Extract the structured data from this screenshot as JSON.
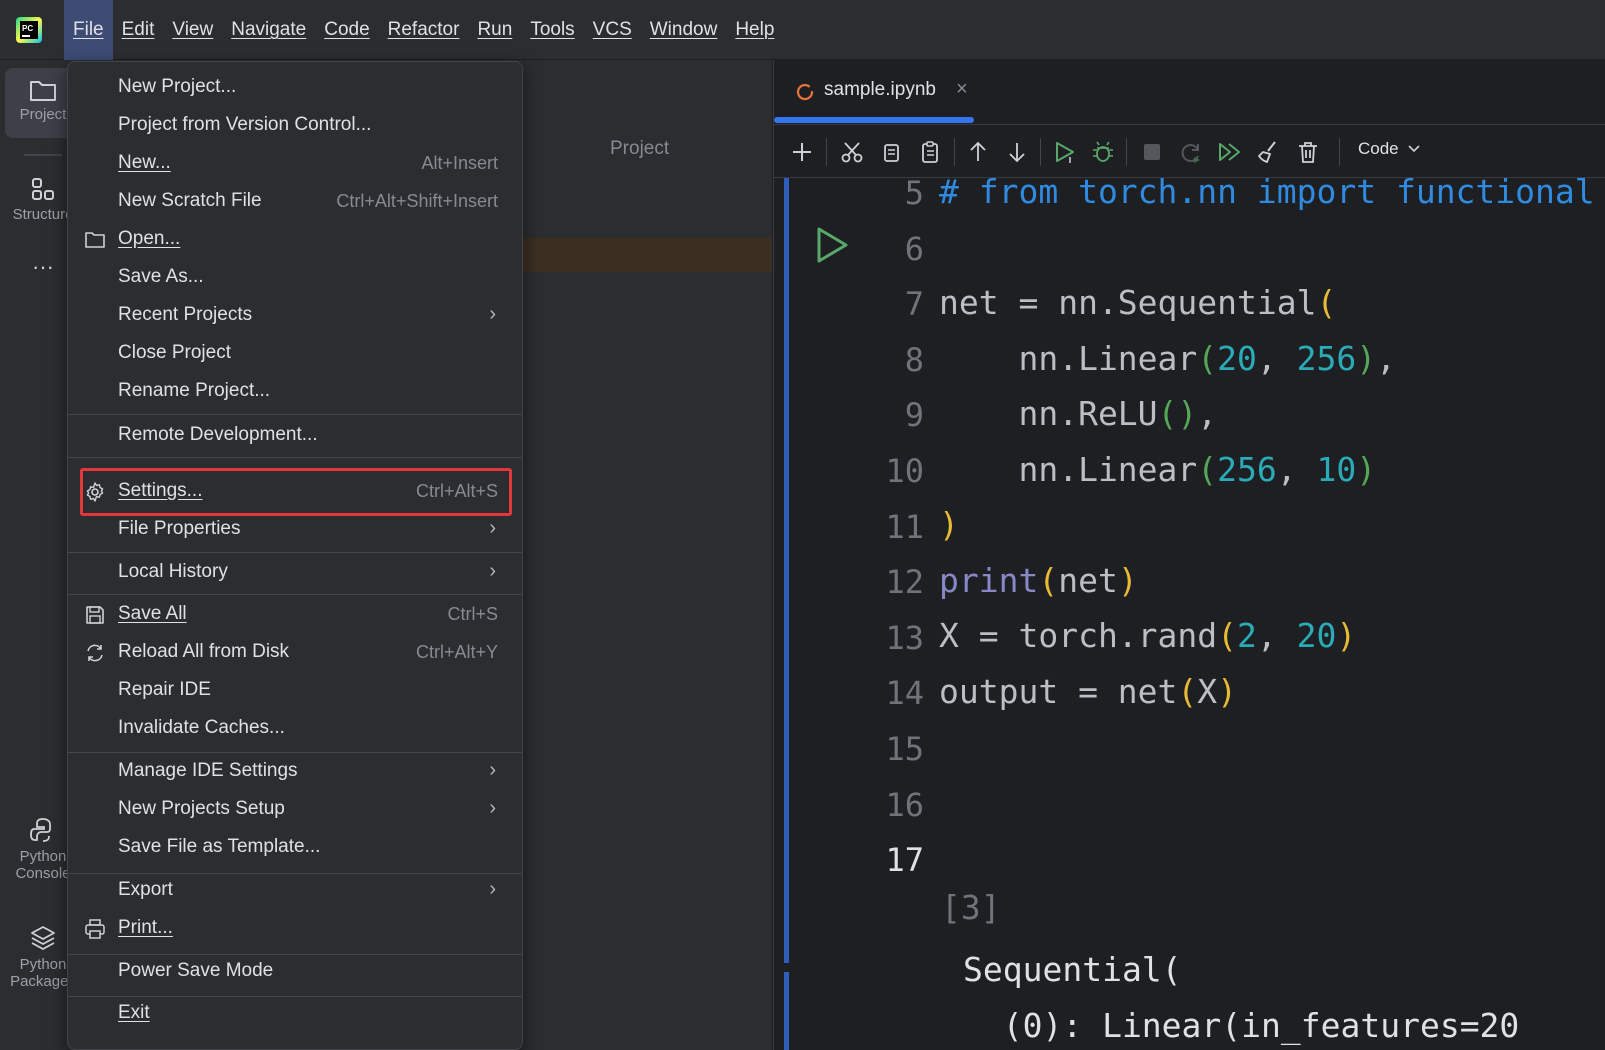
{
  "menubar": {
    "items": [
      "File",
      "Edit",
      "View",
      "Navigate",
      "Code",
      "Refactor",
      "Run",
      "Tools",
      "VCS",
      "Window",
      "Help"
    ]
  },
  "toolstrip": {
    "project": "Project",
    "structure": "Structure",
    "more": "···",
    "python_console": [
      "Python",
      "Console"
    ],
    "python_packages": [
      "Python",
      "Packages"
    ]
  },
  "project_panel": {
    "header": "Project"
  },
  "editor": {
    "tab_label": "sample.ipynb",
    "tab_close": "×",
    "kernel_select": "Code",
    "line_numbers": [
      "5",
      "6",
      "7",
      "8",
      "9",
      "10",
      "11",
      "12",
      "13",
      "14",
      "15",
      "16",
      "17"
    ],
    "exec_count": "[3]",
    "output_lines": [
      "Sequential(",
      "  (0): Linear(in_features=20"
    ]
  },
  "file_menu": {
    "items": [
      {
        "label": "New Project...",
        "shortcut": ""
      },
      {
        "label": "Project from Version Control...",
        "shortcut": ""
      },
      {
        "label": "New...",
        "shortcut": "Alt+Insert"
      },
      {
        "label": "New Scratch File",
        "shortcut": "Ctrl+Alt+Shift+Insert"
      },
      {
        "label": "Open...",
        "shortcut": "",
        "icon": "folder-icon"
      },
      {
        "label": "Save As...",
        "shortcut": ""
      },
      {
        "label": "Recent Projects",
        "shortcut": "",
        "submenu": true
      },
      {
        "label": "Close Project",
        "shortcut": ""
      },
      {
        "label": "Rename Project...",
        "shortcut": ""
      },
      {
        "label": "Remote Development...",
        "shortcut": ""
      },
      {
        "label": "Settings...",
        "shortcut": "Ctrl+Alt+S",
        "icon": "gear-icon",
        "highlighted": true
      },
      {
        "label": "File Properties",
        "shortcut": "",
        "submenu": true
      },
      {
        "label": "Local History",
        "shortcut": "",
        "submenu": true
      },
      {
        "label": "Save All",
        "shortcut": "Ctrl+S",
        "icon": "save-icon"
      },
      {
        "label": "Reload All from Disk",
        "shortcut": "Ctrl+Alt+Y",
        "icon": "reload-icon"
      },
      {
        "label": "Repair IDE",
        "shortcut": ""
      },
      {
        "label": "Invalidate Caches...",
        "shortcut": ""
      },
      {
        "label": "Manage IDE Settings",
        "shortcut": "",
        "submenu": true
      },
      {
        "label": "New Projects Setup",
        "shortcut": "",
        "submenu": true
      },
      {
        "label": "Save File as Template...",
        "shortcut": ""
      },
      {
        "label": "Export",
        "shortcut": "",
        "submenu": true
      },
      {
        "label": "Print...",
        "shortcut": "",
        "icon": "print-icon"
      },
      {
        "label": "Power Save Mode",
        "shortcut": ""
      },
      {
        "label": "Exit",
        "shortcut": ""
      }
    ],
    "submenu_arrow": "›"
  },
  "colors": {
    "accent": "#3574f0",
    "highlight_box": "#e5383b",
    "comment": "#2f8ae0",
    "number": "#2aacb8",
    "builtin": "#8888c6"
  }
}
